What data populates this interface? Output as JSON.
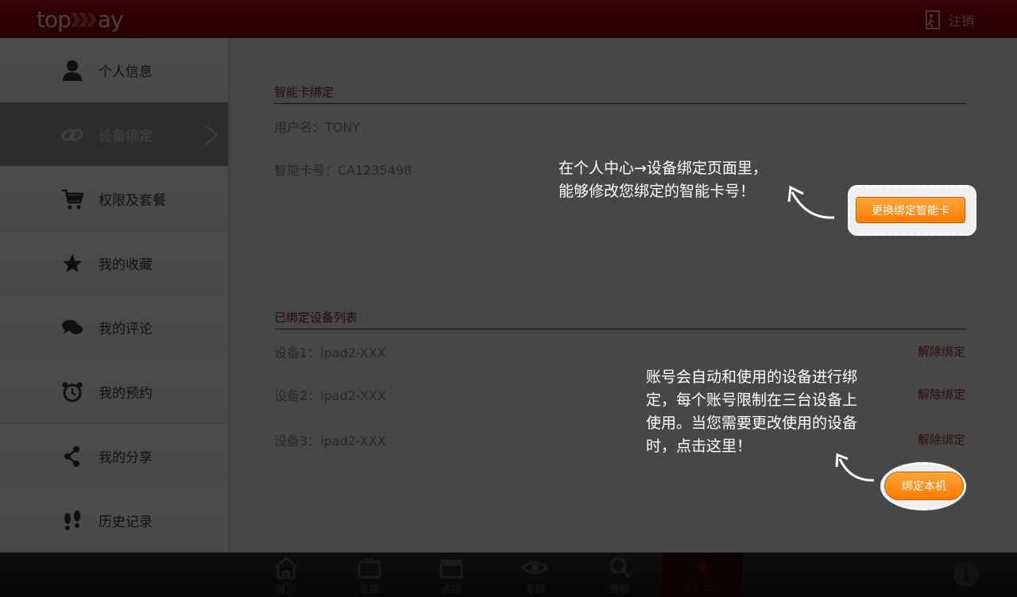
{
  "header": {
    "logo_left": "top",
    "logo_right": "ay",
    "logout_label": "注销"
  },
  "sidebar": {
    "items": [
      {
        "label": "个人信息",
        "icon": "user-icon"
      },
      {
        "label": "设备绑定",
        "icon": "link-icon",
        "active": true
      },
      {
        "label": "权限及套餐",
        "icon": "cart-icon"
      },
      {
        "label": "我的收藏",
        "icon": "star-icon"
      },
      {
        "label": "我的评论",
        "icon": "comment-icon"
      },
      {
        "label": "我的预约",
        "icon": "alarm-clock-icon"
      },
      {
        "label": "我的分享",
        "icon": "share-icon"
      },
      {
        "label": "历史记录",
        "icon": "footprints-icon"
      }
    ]
  },
  "card_section": {
    "title": "智能卡绑定",
    "username": "用户名：TONY",
    "card_number": "智能卡号：CA1235498",
    "change_button": "更换绑定智能卡"
  },
  "device_section": {
    "title": "已绑定设备列表",
    "devices": [
      {
        "name": "设备1：ipad2-XXX",
        "action": "解除绑定"
      },
      {
        "name": "设备2：ipad2-XXX",
        "action": "解除绑定"
      },
      {
        "name": "设备3：ipad2-XXX",
        "action": "解除绑定"
      }
    ],
    "bind_button": "绑定本机"
  },
  "tips": {
    "tip1_line1": "在个人中心→设备绑定页面里，",
    "tip1_line2": "能够修改您绑定的智能卡号！",
    "tip2_line1": "账号会自动和使用的设备进行绑",
    "tip2_line2": "定，每个账号限制在三台设备上",
    "tip2_line3": "使用。当您需要更改使用的设备",
    "tip2_line4": "时，点击这里！"
  },
  "bottom_nav": {
    "tabs": [
      {
        "label": "首页",
        "icon": "home-icon"
      },
      {
        "label": "直播",
        "icon": "tv-icon"
      },
      {
        "label": "点播",
        "icon": "clapperboard-icon"
      },
      {
        "label": "专题",
        "icon": "eye-icon"
      },
      {
        "label": "搜索",
        "icon": "search-icon"
      },
      {
        "label": "个人中心",
        "icon": "star-icon",
        "active": true
      }
    ],
    "info_label": "i"
  },
  "colors": {
    "header_red": "#a30f0f",
    "accent_orange": "#ff8a12",
    "section_title": "#7a1616"
  }
}
